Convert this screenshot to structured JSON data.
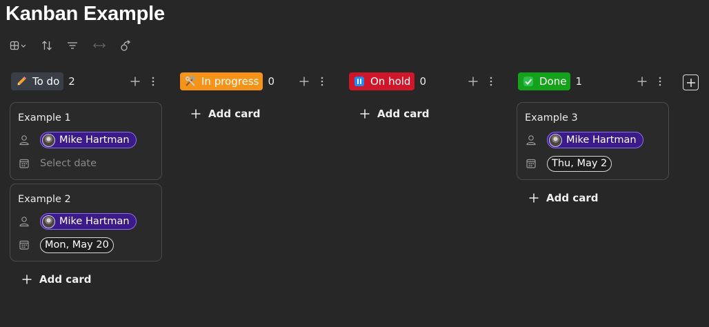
{
  "page": {
    "title": "Kanban Example"
  },
  "toolbar": {
    "icons": [
      "layout-icon",
      "sort-icon",
      "filter-icon",
      "resize-icon",
      "automation-icon"
    ]
  },
  "columns": [
    {
      "label": "To do",
      "count": "2",
      "color": "#3a3f47",
      "emoji": "pencil-icon",
      "cards": [
        {
          "title": "Example 1",
          "person": "Mike Hartman",
          "date": "",
          "date_placeholder": "Select date"
        },
        {
          "title": "Example 2",
          "person": "Mike Hartman",
          "date": "Mon, May 20"
        }
      ],
      "add_label": "Add card"
    },
    {
      "label": "In progress",
      "count": "0",
      "color": "#f59418",
      "emoji": "hammer-wrench-icon",
      "cards": [],
      "add_label": "Add card"
    },
    {
      "label": "On hold",
      "count": "0",
      "color": "#d0162b",
      "emoji": "pause-icon",
      "cards": [],
      "add_label": "Add card"
    },
    {
      "label": "Done",
      "count": "1",
      "color": "#14a21a",
      "emoji": "check-icon",
      "cards": [
        {
          "title": "Example 3",
          "person": "Mike Hartman",
          "date": "Thu, May 2"
        }
      ],
      "add_label": "Add card"
    }
  ]
}
